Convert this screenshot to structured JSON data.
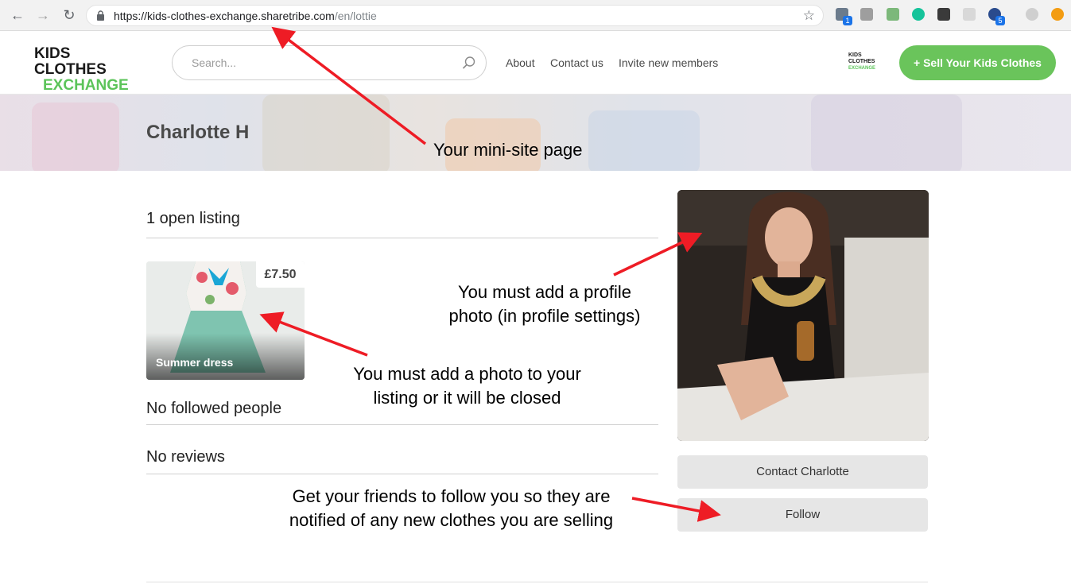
{
  "browser": {
    "url_host": "https://kids-clothes-exchange.sharetribe.com",
    "url_path": "/en/lottie",
    "icons": [
      "back-icon",
      "forward-icon",
      "reload-icon",
      "lock-icon",
      "bookmark-star-icon"
    ],
    "extension_badges": [
      "1",
      "5"
    ]
  },
  "header": {
    "logo_line1": "KIDS CLOTHES",
    "logo_line2": "EXCHANGE",
    "search_placeholder": "Search...",
    "menu": [
      "About",
      "Contact us",
      "Invite new members"
    ],
    "mini_logo": [
      "KIDS",
      "CLOTHES",
      "EXCHANGE"
    ],
    "sell_button": "+ Sell Your Kids Clothes",
    "accent_color": "#6ac45b"
  },
  "hero": {
    "name": "Charlotte H"
  },
  "profile": {
    "open_listings_title": "1 open listing",
    "listing": {
      "price": "£7.50",
      "title": "Summer dress"
    },
    "followed_title": "No followed people",
    "reviews_title": "No reviews",
    "contact_button": "Contact Charlotte",
    "follow_button": "Follow"
  },
  "annotations": {
    "mini_site": "Your mini-site page",
    "profile_photo_line1": "You must add a profile",
    "profile_photo_line2": "photo (in profile settings)",
    "listing_photo_line1": "You must add a photo to your",
    "listing_photo_line2": "listing or it will be closed",
    "follow_line1": "Get your friends to follow you so they are",
    "follow_line2": "notified of any new clothes you are selling",
    "arrow_color": "#ee1c25"
  }
}
